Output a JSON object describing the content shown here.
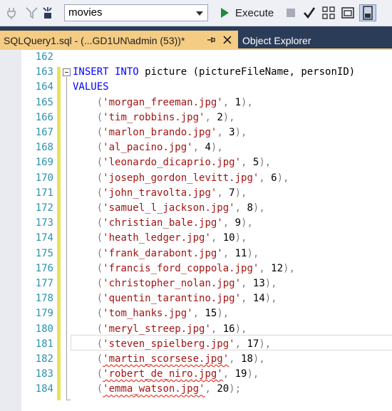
{
  "toolbar": {
    "database": "movies",
    "execute_label": "Execute"
  },
  "tabs": {
    "active_label": "SQLQuery1.sql - (...GD1UN\\admin (53))*",
    "inactive_label": "Object Explorer"
  },
  "editor": {
    "line_numbers": [
      "162",
      "163",
      "164",
      "165",
      "166",
      "167",
      "168",
      "169",
      "170",
      "171",
      "172",
      "173",
      "174",
      "175",
      "176",
      "177",
      "178",
      "179",
      "180",
      "181",
      "182",
      "183",
      "184"
    ],
    "statement": {
      "insert_kw": "INSERT INTO",
      "table": "picture",
      "columns": "(pictureFileName, personID)",
      "values_kw": "VALUES"
    },
    "rows": [
      {
        "file": "'morgan_freeman.jpg'",
        "id": "1",
        "end": "),"
      },
      {
        "file": "'tim_robbins.jpg'",
        "id": "2",
        "end": "),"
      },
      {
        "file": "'marlon_brando.jpg'",
        "id": "3",
        "end": "),"
      },
      {
        "file": "'al_pacino.jpg'",
        "id": "4",
        "end": "),"
      },
      {
        "file": "'leonardo_dicaprio.jpg'",
        "id": "5",
        "end": "),"
      },
      {
        "file": "'joseph_gordon_levitt.jpg'",
        "id": "6",
        "end": "),"
      },
      {
        "file": "'john_travolta.jpg'",
        "id": "7",
        "end": "),"
      },
      {
        "file": "'samuel_l_jackson.jpg'",
        "id": "8",
        "end": "),"
      },
      {
        "file": "'christian_bale.jpg'",
        "id": "9",
        "end": "),"
      },
      {
        "file": "'heath_ledger.jpg'",
        "id": "10",
        "end": "),"
      },
      {
        "file": "'frank_darabont.jpg'",
        "id": "11",
        "end": "),"
      },
      {
        "file": "'francis_ford_coppola.jpg'",
        "id": "12",
        "end": "),"
      },
      {
        "file": "'christopher_nolan.jpg'",
        "id": "13",
        "end": "),"
      },
      {
        "file": "'quentin_tarantino.jpg'",
        "id": "14",
        "end": "),"
      },
      {
        "file": "'tom_hanks.jpg'",
        "id": "15",
        "end": "),"
      },
      {
        "file": "'meryl_streep.jpg'",
        "id": "16",
        "end": "),"
      },
      {
        "file": "'steven_spielberg.jpg'",
        "id": "17",
        "end": "),"
      },
      {
        "file": "'martin_scorsese.jpg'",
        "id": "18",
        "end": "),"
      },
      {
        "file": "'robert_de_niro.jpg'",
        "id": "19",
        "end": "),"
      },
      {
        "file": "'emma_watson.jpg'",
        "id": "20",
        "end": ");"
      }
    ]
  },
  "colors": {
    "keyword": "#0000ff",
    "string": "#a31515",
    "punctuation": "#808080",
    "line_number": "#2b91af",
    "tab_active": "#f5cc84",
    "tab_bar": "#2b3c59"
  },
  "icons": [
    "connect-plug-icon",
    "filter-icon",
    "database-select-caret-icon",
    "execute-play-icon",
    "stop-icon",
    "parse-check-icon",
    "query-plan-icon",
    "results-to-text-icon",
    "results-to-grid-icon",
    "pin-icon",
    "close-icon"
  ]
}
